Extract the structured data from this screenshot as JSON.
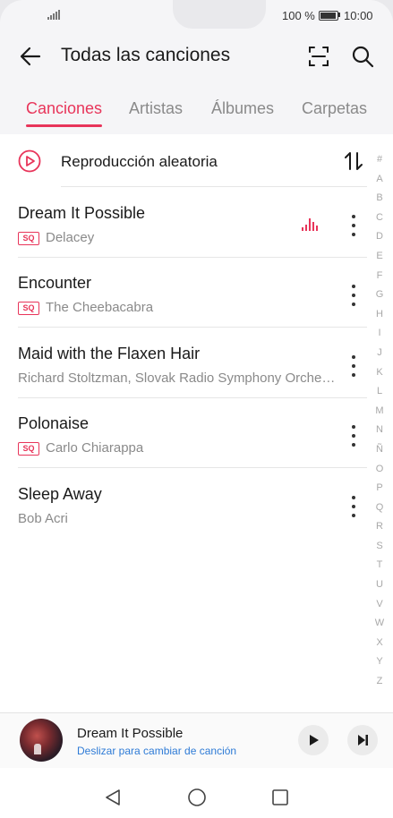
{
  "status_bar": {
    "battery": "100 %",
    "time": "10:00"
  },
  "header": {
    "title": "Todas las canciones"
  },
  "tabs": [
    {
      "label": "Canciones",
      "active": true
    },
    {
      "label": "Artistas",
      "active": false
    },
    {
      "label": "Álbumes",
      "active": false
    },
    {
      "label": "Carpetas",
      "active": false
    }
  ],
  "shuffle": {
    "label": "Reproducción aleatoria"
  },
  "songs": [
    {
      "title": "Dream It Possible",
      "artist": "Delacey",
      "badge": "SQ",
      "playing": true
    },
    {
      "title": "Encounter",
      "artist": "The Cheebacabra",
      "badge": "SQ",
      "playing": false
    },
    {
      "title": "Maid with the Flaxen Hair",
      "artist": "Richard Stoltzman, Slovak Radio Symphony Orche…",
      "badge": "",
      "playing": false
    },
    {
      "title": "Polonaise",
      "artist": "Carlo Chiarappa",
      "badge": "SQ",
      "playing": false
    },
    {
      "title": "Sleep Away",
      "artist": "Bob Acri",
      "badge": "",
      "playing": false
    }
  ],
  "alphabet": [
    "#",
    "A",
    "B",
    "C",
    "D",
    "E",
    "F",
    "G",
    "H",
    "I",
    "J",
    "K",
    "L",
    "M",
    "N",
    "Ñ",
    "O",
    "P",
    "Q",
    "R",
    "S",
    "T",
    "U",
    "V",
    "W",
    "X",
    "Y",
    "Z"
  ],
  "now_playing": {
    "title": "Dream It Possible",
    "hint": "Deslizar para cambiar de canción"
  },
  "colors": {
    "accent": "#e8355a",
    "hint": "#2e7bd6"
  }
}
